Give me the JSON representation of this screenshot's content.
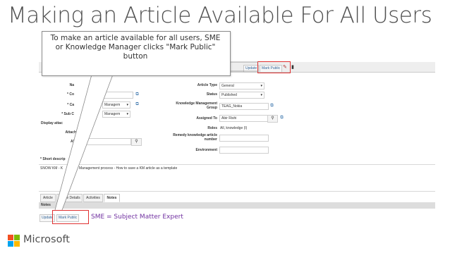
{
  "slide": {
    "title": "Making an Article Available For All Users",
    "callout": "To make an article available for all users, SME or Knowledge Manager clicks \"Mark Public\" button",
    "sme_note": "SME = Subject Matter Expert",
    "brand": "Microsoft"
  },
  "toolbar": {
    "update_label": "Update",
    "mark_public_label": "Mark Public",
    "edit_icon": "pencil-icon"
  },
  "form": {
    "left_labels": [
      "Na",
      "* Co",
      "* Ca",
      "* Sub C",
      "Display attac",
      "Attach",
      "Al"
    ],
    "category_value": "Managem",
    "subcategory_value": "Managem",
    "article_type_label": "Article Type",
    "article_type_value": "General",
    "status_label": "Status",
    "status_value": "Published",
    "km_group_label": "Knowledge Management Group",
    "km_group_value": "TEAG_Nokia",
    "assigned_to_label": "Assigned To",
    "assigned_to_value": "Abir Rishi",
    "roles_label": "Roles",
    "roles_value": "All, knowledge (I)",
    "remedy_label": "Remedy knowledge article number",
    "environment_label": "Environment",
    "short_desc_label": "* Short descrip",
    "short_desc_left": "SNOW KM - K",
    "short_desc_right": "Management process - How to save a KM article as a template"
  },
  "tabs": [
    {
      "label": "Article"
    },
    {
      "label": "Article Details"
    },
    {
      "label": "Activities"
    },
    {
      "label": "Notes"
    }
  ],
  "notes": {
    "header": "Notes"
  },
  "bottom": {
    "update_label": "Update",
    "mark_public_label": "Mark Public"
  },
  "colors": {
    "highlight": "#e03030",
    "sme_text": "#7030a0",
    "link": "#336699"
  }
}
